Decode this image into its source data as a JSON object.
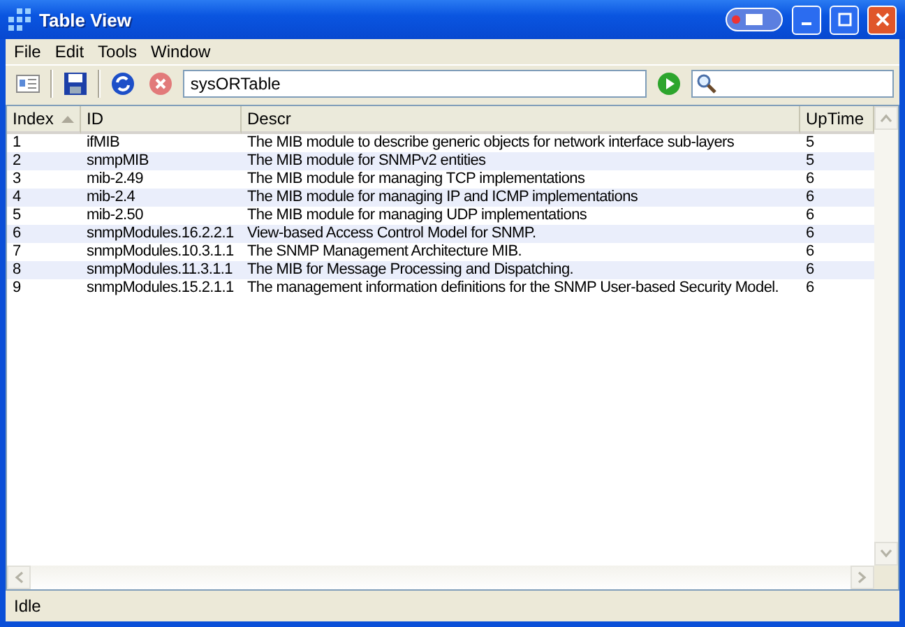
{
  "window": {
    "title": "Table View"
  },
  "menu": [
    "File",
    "Edit",
    "Tools",
    "Window"
  ],
  "toolbar": {
    "address": "sysORTable"
  },
  "table": {
    "columns": [
      {
        "label": "Index",
        "sorted": true
      },
      {
        "label": "ID",
        "sorted": false
      },
      {
        "label": "Descr",
        "sorted": false
      },
      {
        "label": "UpTime",
        "sorted": false
      }
    ],
    "rows": [
      [
        "1",
        "ifMIB",
        "The MIB module to describe generic objects for network interface sub-layers",
        "5"
      ],
      [
        "2",
        "snmpMIB",
        "The MIB module for SNMPv2 entities",
        "5"
      ],
      [
        "3",
        "mib-2.49",
        "The MIB module for managing TCP implementations",
        "6"
      ],
      [
        "4",
        "mib-2.4",
        "The MIB module for managing IP and ICMP implementations",
        "6"
      ],
      [
        "5",
        "mib-2.50",
        "The MIB module for managing UDP implementations",
        "6"
      ],
      [
        "6",
        "snmpModules.16.2.2.1",
        "View-based Access Control Model for SNMP.",
        "6"
      ],
      [
        "7",
        "snmpModules.10.3.1.1",
        "The SNMP Management Architecture MIB.",
        "6"
      ],
      [
        "8",
        "snmpModules.11.3.1.1",
        "The MIB for Message Processing and Dispatching.",
        "6"
      ],
      [
        "9",
        "snmpModules.15.2.1.1",
        "The management information definitions for the SNMP User-based Security Model.",
        "6"
      ]
    ]
  },
  "status_bar": "Idle"
}
